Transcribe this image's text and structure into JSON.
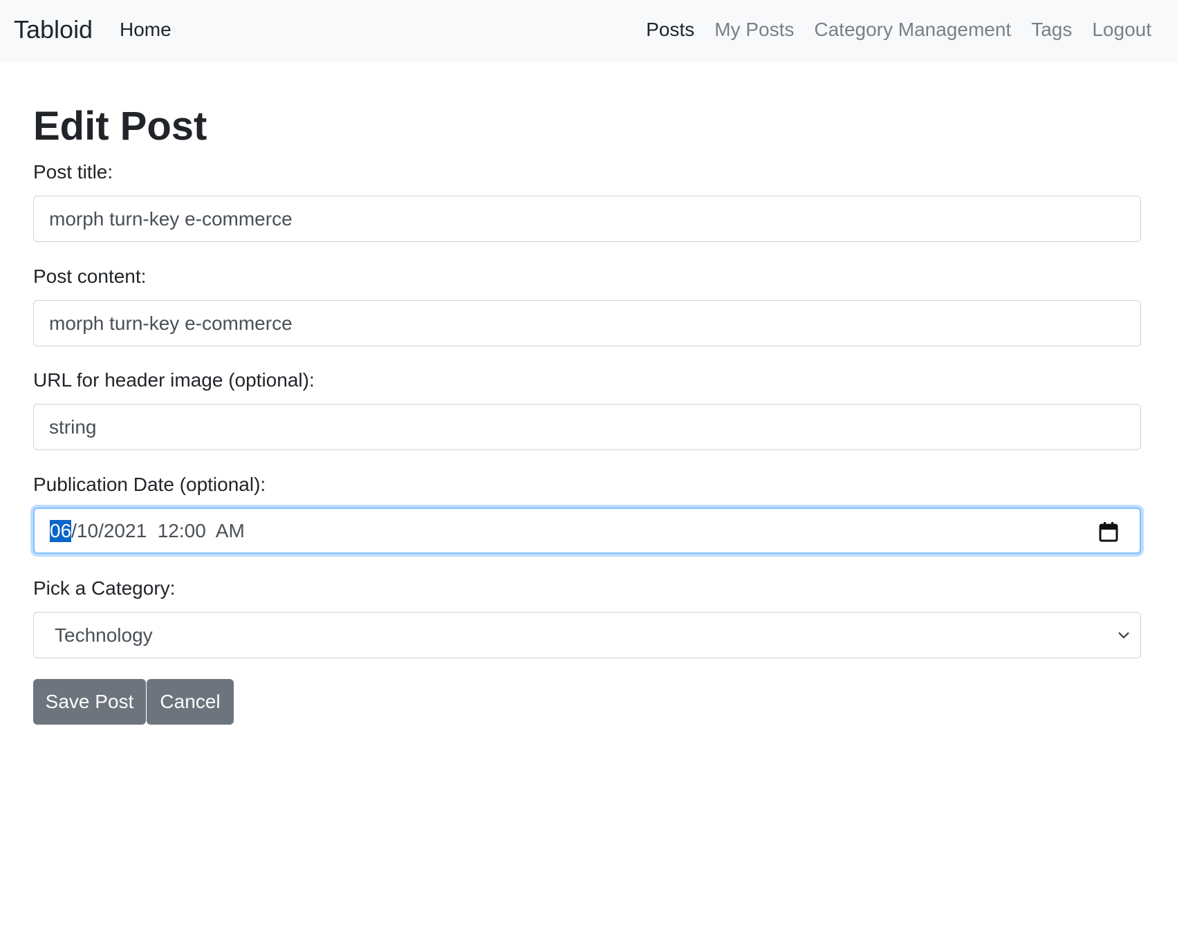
{
  "navbar": {
    "brand": "Tabloid",
    "home": "Home",
    "links": {
      "posts": "Posts",
      "my_posts": "My Posts",
      "category_management": "Category Management",
      "tags": "Tags",
      "logout": "Logout"
    },
    "active_link": "Posts"
  },
  "form": {
    "title": "Edit Post",
    "post_title_label": "Post title:",
    "post_title_value": "morph turn-key e-commerce",
    "post_content_label": "Post content:",
    "post_content_value": "morph turn-key e-commerce",
    "image_url_label": "URL for header image (optional):",
    "image_url_value": "string",
    "pub_date_label": "Publication Date (optional):",
    "pub_date_month": "06",
    "pub_date_rest": "/10/2021  12:00  AM",
    "category_label": "Pick a Category:",
    "category_selected": "Technology",
    "save_label": "Save Post",
    "cancel_label": "Cancel"
  },
  "icons": {
    "calendar": "calendar-icon",
    "chevron": "chevron-down-icon"
  },
  "colors": {
    "button_bg": "#6c757d",
    "focus_border": "#80bdff",
    "selection": "#0b64c8"
  }
}
